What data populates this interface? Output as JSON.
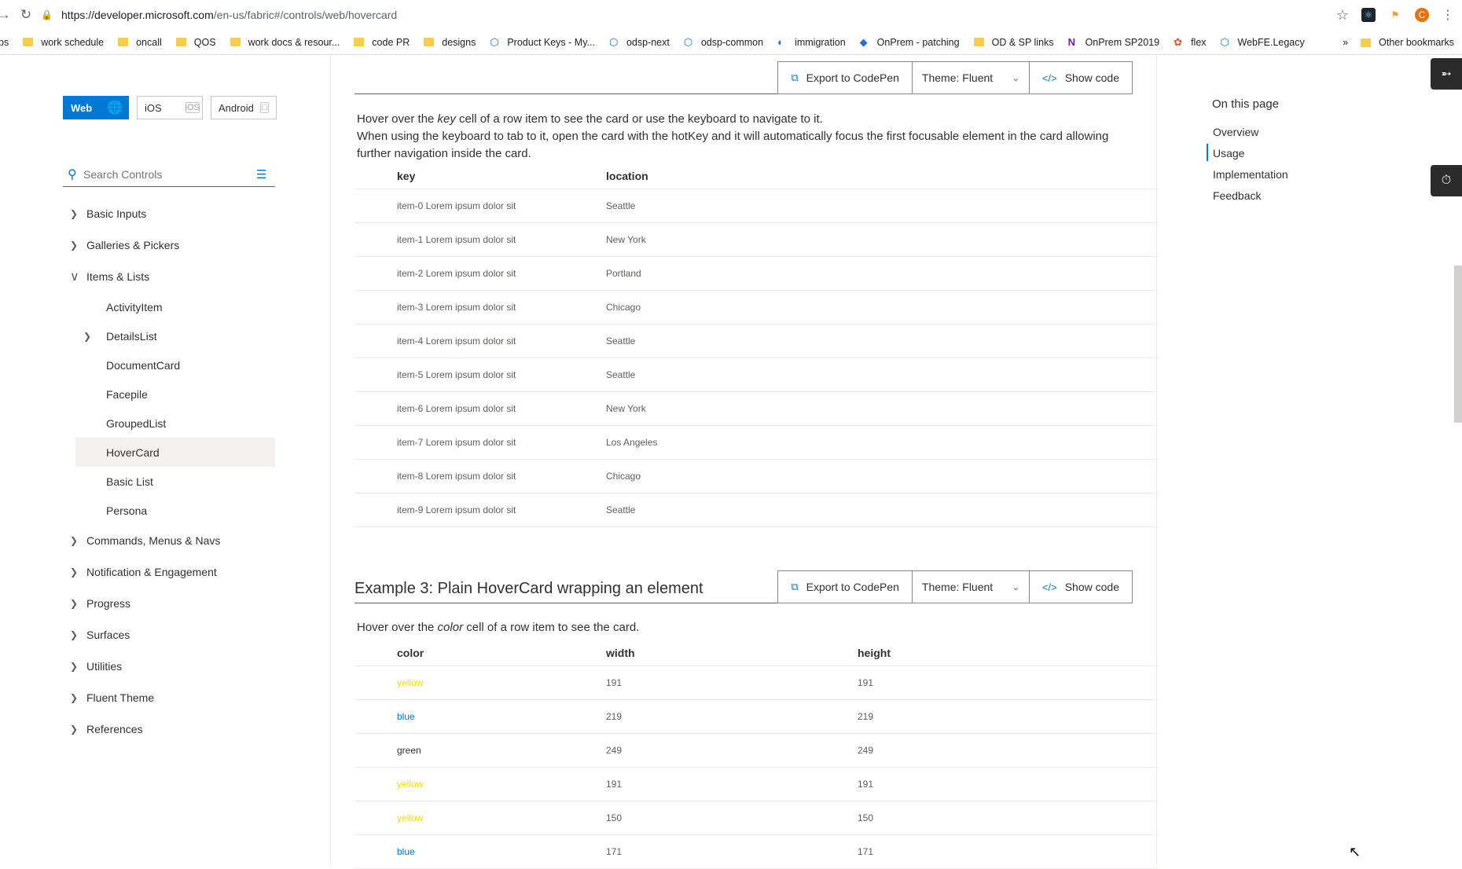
{
  "browser": {
    "url_host": "https://developer.microsoft.com",
    "url_path": "/en-us/fabric#/controls/web/hovercard",
    "bookmarks": [
      {
        "label": "ps",
        "kind": "text"
      },
      {
        "label": "work schedule",
        "kind": "folder"
      },
      {
        "label": "oncall",
        "kind": "folder"
      },
      {
        "label": "QOS",
        "kind": "folder"
      },
      {
        "label": "work docs & resour...",
        "kind": "folder"
      },
      {
        "label": "code PR",
        "kind": "folder"
      },
      {
        "label": "designs",
        "kind": "folder"
      },
      {
        "label": "Product Keys - My...",
        "kind": "ado"
      },
      {
        "label": "odsp-next",
        "kind": "ado"
      },
      {
        "label": "odsp-common",
        "kind": "ado"
      },
      {
        "label": "immigration",
        "kind": "globe"
      },
      {
        "label": "OnPrem - patching",
        "kind": "sp"
      },
      {
        "label": "OD & SP links",
        "kind": "folder"
      },
      {
        "label": "OnPrem SP2019",
        "kind": "onenote"
      },
      {
        "label": "flex",
        "kind": "flex"
      },
      {
        "label": "WebFE.Legacy",
        "kind": "ado"
      }
    ],
    "other_bookmarks": "Other bookmarks",
    "more_glyph": "»",
    "profile_initial": "C"
  },
  "platform": {
    "web": "Web",
    "ios": "iOS",
    "android": "Android"
  },
  "search": {
    "placeholder": "Search Controls"
  },
  "nav": {
    "groups_top": [
      {
        "label": "Basic Inputs"
      },
      {
        "label": "Galleries & Pickers"
      },
      {
        "label": "Items & Lists"
      }
    ],
    "items_lists": [
      {
        "label": "ActivityItem",
        "has_children": false
      },
      {
        "label": "DetailsList",
        "has_children": true
      },
      {
        "label": "DocumentCard",
        "has_children": false
      },
      {
        "label": "Facepile",
        "has_children": false
      },
      {
        "label": "GroupedList",
        "has_children": false
      },
      {
        "label": "HoverCard",
        "has_children": false,
        "selected": true
      },
      {
        "label": "Basic List",
        "has_children": false
      },
      {
        "label": "Persona",
        "has_children": false
      }
    ],
    "groups_bottom": [
      {
        "label": "Commands, Menus & Navs"
      },
      {
        "label": "Notification & Engagement"
      },
      {
        "label": "Progress"
      },
      {
        "label": "Surfaces"
      },
      {
        "label": "Utilities"
      },
      {
        "label": "Fluent Theme"
      },
      {
        "label": "References"
      }
    ]
  },
  "example2": {
    "export_label": "Export to CodePen",
    "theme_label": "Theme: Fluent",
    "show_code_label": "Show code",
    "desc_pre": "Hover over the ",
    "desc_em": "key",
    "desc_post": " cell of a row item to see the card or use the keyboard to navigate to it.",
    "desc_line2": "When using the keyboard to tab to it, open the card with the hotKey and it will automatically focus the first focusable element in the card allowing further navigation inside the card.",
    "columns": [
      "key",
      "location"
    ],
    "rows": [
      [
        "item-0 Lorem ipsum dolor sit",
        "Seattle"
      ],
      [
        "item-1 Lorem ipsum dolor sit",
        "New York"
      ],
      [
        "item-2 Lorem ipsum dolor sit",
        "Portland"
      ],
      [
        "item-3 Lorem ipsum dolor sit",
        "Chicago"
      ],
      [
        "item-4 Lorem ipsum dolor sit",
        "Seattle"
      ],
      [
        "item-5 Lorem ipsum dolor sit",
        "Seattle"
      ],
      [
        "item-6 Lorem ipsum dolor sit",
        "New York"
      ],
      [
        "item-7 Lorem ipsum dolor sit",
        "Los Angeles"
      ],
      [
        "item-8 Lorem ipsum dolor sit",
        "Chicago"
      ],
      [
        "item-9 Lorem ipsum dolor sit",
        "Seattle"
      ]
    ]
  },
  "example3": {
    "title": "Example 3: Plain HoverCard wrapping an element",
    "export_label": "Export to CodePen",
    "theme_label": "Theme: Fluent",
    "show_code_label": "Show code",
    "desc_pre": "Hover over the ",
    "desc_em": "color",
    "desc_post": " cell of a row item to see the card.",
    "columns": [
      "color",
      "width",
      "height"
    ],
    "rows": [
      {
        "color": "yellow",
        "width": "191",
        "height": "191",
        "hex": "#f4dc00"
      },
      {
        "color": "blue",
        "width": "219",
        "height": "219",
        "hex": "#0078d4"
      },
      {
        "color": "green",
        "width": "249",
        "height": "249",
        "hex": "#323130"
      },
      {
        "color": "yellow",
        "width": "191",
        "height": "191",
        "hex": "#f4dc00"
      },
      {
        "color": "yellow",
        "width": "150",
        "height": "150",
        "hex": "#f4dc00"
      },
      {
        "color": "blue",
        "width": "171",
        "height": "171",
        "hex": "#0078d4"
      }
    ]
  },
  "toc": {
    "title": "On this page",
    "items": [
      "Overview",
      "Usage",
      "Implementation",
      "Feedback"
    ],
    "active_index": 1
  },
  "colors": {
    "accent": "#0078d4"
  }
}
